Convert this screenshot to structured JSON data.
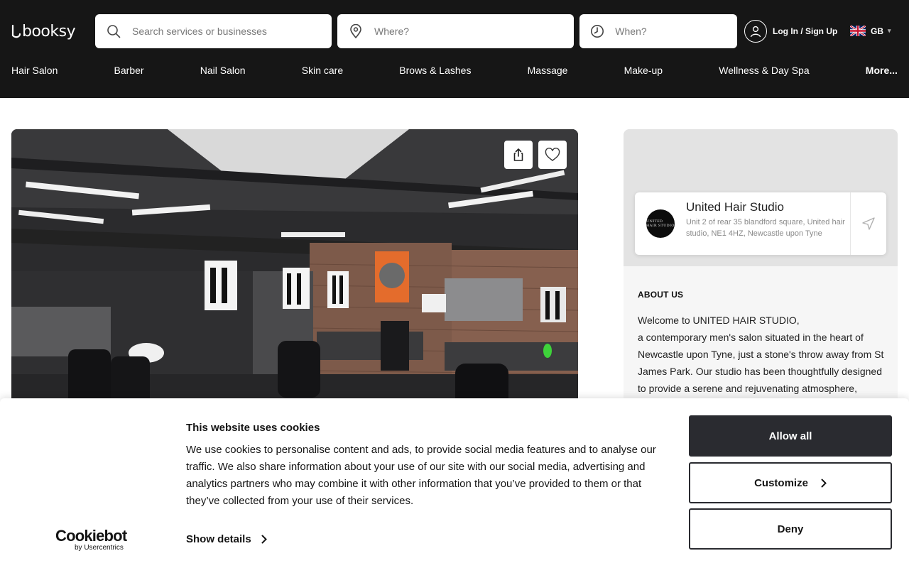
{
  "header": {
    "logo_text": "booksy",
    "search_placeholder": "Search services or businesses",
    "where_placeholder": "Where?",
    "when_placeholder": "When?",
    "login_label": "Log In / Sign Up",
    "language_code": "GB"
  },
  "categories": [
    "Hair Salon",
    "Barber",
    "Nail Salon",
    "Skin care",
    "Brows & Lashes",
    "Massage",
    "Make-up",
    "Wellness & Day Spa",
    "More..."
  ],
  "business": {
    "name": "United Hair Studio",
    "address": "Unit 2 of rear 35 blandford square, United hair studio, NE1 4HZ, Newcastle upon Tyne",
    "logo_text": "UNITED HAIR STUDIO"
  },
  "about": {
    "heading": "ABOUT US",
    "text_line1": "Welcome to UNITED HAIR STUDIO,",
    "text_rest": "a contemporary men's salon situated in the heart of Newcastle upon Tyne, just a stone's throw away from St James Park. Our studio has been thoughtfully designed to provide a serene and rejuvenating atmosphere,"
  },
  "cookie_banner": {
    "title": "This website uses cookies",
    "body": "We use cookies to personalise content and ads, to provide social media features and to analyse our traffic. We also share information about your use of our site with our social media, advertising and analytics partners who may combine it with other information that you’ve provided to them or that they’ve collected from your use of their services.",
    "show_details_label": "Show details",
    "allow_all_label": "Allow all",
    "customize_label": "Customize",
    "deny_label": "Deny",
    "provider_logo": "Cookiebot",
    "provider_sub": "by Usercentrics"
  },
  "colors": {
    "header_bg": "#161616",
    "primary_button": "#2a2b30",
    "panel_bg": "#f6f6f6"
  },
  "icons": {
    "search": "search-icon",
    "location": "location-pin-icon",
    "time": "clock-icon",
    "user": "user-icon",
    "flag": "uk-flag-icon",
    "share": "share-icon",
    "favorite": "heart-icon",
    "directions": "navigation-arrow-icon"
  }
}
